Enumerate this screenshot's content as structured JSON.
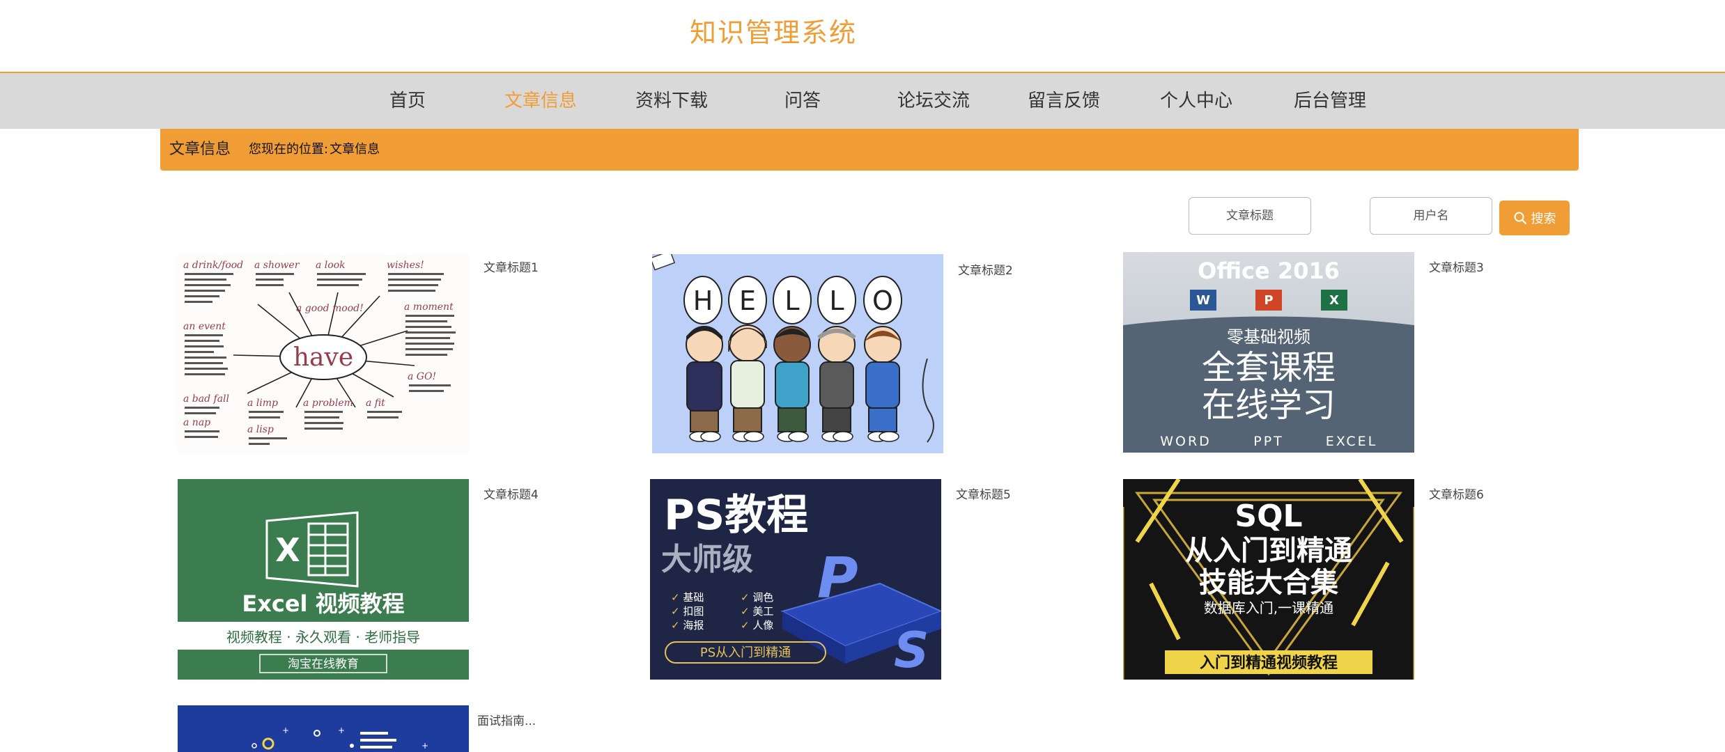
{
  "site": {
    "title": "知识管理系统"
  },
  "nav": {
    "items": [
      {
        "label": "首页"
      },
      {
        "label": "文章信息"
      },
      {
        "label": "资料下载"
      },
      {
        "label": "问答"
      },
      {
        "label": "论坛交流"
      },
      {
        "label": "留言反馈"
      },
      {
        "label": "个人中心"
      },
      {
        "label": "后台管理"
      }
    ],
    "active_index": 1
  },
  "breadcrumb": {
    "title": "文章信息",
    "position_label": "您现在的位置:",
    "position_value": "文章信息"
  },
  "search": {
    "title_placeholder": "文章标题",
    "user_placeholder": "用户名",
    "button_label": "搜索",
    "icon": "search-icon"
  },
  "articles": [
    {
      "title": "文章标题1",
      "thumb": {
        "center_word": "have",
        "labels": [
          "a drink/food",
          "a shower",
          "a look",
          "wishes!",
          "an event",
          "a good mood!",
          "a moment",
          "a bad fall",
          "a limp",
          "a problem",
          "a fit",
          "a nap",
          "a lisp",
          "a GO!"
        ]
      }
    },
    {
      "title": "文章标题2",
      "thumb": {
        "letters": [
          "H",
          "E",
          "L",
          "L",
          "O"
        ]
      }
    },
    {
      "title": "文章标题3",
      "thumb": {
        "heading": "Office 2016",
        "sub": "零基础视频",
        "line1": "全套课程",
        "line2": "在线学习",
        "footer": [
          "WORD",
          "PPT",
          "EXCEL"
        ]
      }
    },
    {
      "title": "文章标题4",
      "thumb": {
        "heading": "Excel 视频教程",
        "sub": "视频教程 · 永久观看 · 老师指导",
        "tag": "淘宝在线教育"
      }
    },
    {
      "title": "文章标题5",
      "thumb": {
        "heading": "PS教程",
        "sub": "大师级",
        "items": [
          "基础",
          "调色",
          "扣图",
          "美工",
          "海报",
          "人像"
        ],
        "tag": "PS从入门到精通"
      }
    },
    {
      "title": "文章标题6",
      "thumb": {
        "line1": "SQL",
        "line2": "从入门到精通",
        "line3": "技能大合集",
        "sub": "数据库入门,一课精通",
        "tag": "入门到精通视频教程"
      }
    },
    {
      "title": "面试指南...",
      "thumb": {}
    }
  ],
  "colors": {
    "accent": "#f19d35",
    "nav_bg": "#d9d9d9"
  }
}
